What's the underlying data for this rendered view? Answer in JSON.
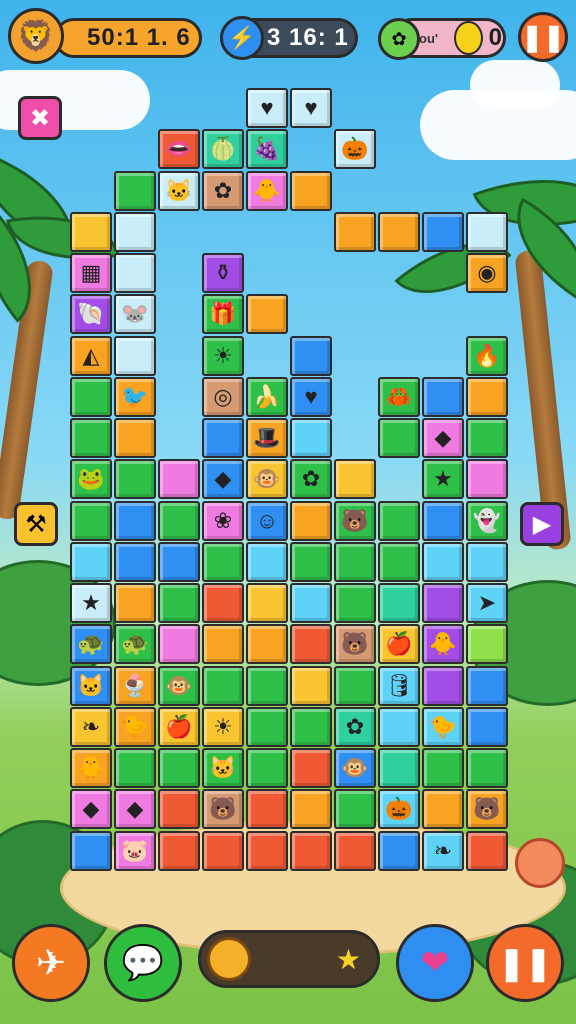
{
  "hud": {
    "score": "50:1 1. 6",
    "energy": "3 16: 1",
    "lives_text": "ou'",
    "coins": "0"
  },
  "colors": {
    "R": "#ef5a35",
    "O": "#f8a321",
    "Y": "#f9c531",
    "G": "#2fc04a",
    "L": "#8fe04a",
    "T": "#2fcfa0",
    "C": "#5fd3f7",
    "B": "#2f8ff2",
    "P": "#a24ee6",
    "K": "#f07be0",
    "M": "#d69a73",
    "E": "#c9eefa"
  },
  "board": {
    "cols": 10,
    "rows": [
      "....EE....",
      "..RTT.E...",
      ".GEMKO....",
      "YE....OOBE",
      "KE.P.....O",
      "PE.GO.....",
      "OE.G.B...G",
      "GO.MGB.GBO",
      "GO.BOC.GKG",
      "GGKBYGY.GK",
      "GBGKBOGGBG",
      "CBBGCGGGCC",
      "EOGRYCGTPC",
      "BGKOORMYPL",
      "BOGGGYGCPB",
      "YOYYGGTCCB",
      "OGGGGRBTGG",
      "KKRMROGCOO",
      "BKRRRRRBCR"
    ],
    "icons": [
      [
        0,
        4,
        "heart-icon"
      ],
      [
        0,
        5,
        "heart-icon"
      ],
      [
        0,
        6,
        "bird-icon"
      ],
      [
        1,
        2,
        "lips-icon"
      ],
      [
        1,
        3,
        "melon-icon"
      ],
      [
        1,
        4,
        "plum-icon"
      ],
      [
        1,
        5,
        "flower-icon"
      ],
      [
        1,
        6,
        "squash-icon"
      ],
      [
        2,
        0,
        "flower-icon"
      ],
      [
        2,
        2,
        "cat-icon"
      ],
      [
        2,
        3,
        "flower-icon"
      ],
      [
        2,
        4,
        "chick-icon"
      ],
      [
        2,
        7,
        "number-icon"
      ],
      [
        2,
        8,
        "number-icon"
      ],
      [
        3,
        2,
        "ghost-icon"
      ],
      [
        3,
        5,
        "squash-icon"
      ],
      [
        4,
        0,
        "net-icon"
      ],
      [
        4,
        3,
        "pot-icon"
      ],
      [
        4,
        6,
        "squash-icon"
      ],
      [
        4,
        9,
        "coin-icon"
      ],
      [
        5,
        0,
        "shell-icon"
      ],
      [
        5,
        1,
        "mouse-icon"
      ],
      [
        5,
        2,
        "pot-icon"
      ],
      [
        5,
        3,
        "gift-icon"
      ],
      [
        6,
        0,
        "cone-icon"
      ],
      [
        6,
        3,
        "sun-icon"
      ],
      [
        6,
        7,
        "mustache-icon"
      ],
      [
        6,
        9,
        "flame-icon"
      ],
      [
        7,
        1,
        "toucan-icon"
      ],
      [
        7,
        2,
        "leaf-icon"
      ],
      [
        7,
        3,
        "eye-icon"
      ],
      [
        7,
        4,
        "banana-icon"
      ],
      [
        7,
        5,
        "heart-icon"
      ],
      [
        7,
        6,
        "hedgehog-icon"
      ],
      [
        7,
        7,
        "crab-icon"
      ],
      [
        8,
        2,
        "gem-icon"
      ],
      [
        8,
        4,
        "hat-icon"
      ],
      [
        8,
        8,
        "gem-icon"
      ],
      [
        9,
        0,
        "frog-icon"
      ],
      [
        9,
        3,
        "gem-icon"
      ],
      [
        9,
        4,
        "monkey-icon"
      ],
      [
        9,
        5,
        "flower-icon"
      ],
      [
        9,
        8,
        "star-icon"
      ],
      [
        10,
        3,
        "bud-icon"
      ],
      [
        10,
        4,
        "face-icon"
      ],
      [
        10,
        6,
        "bear-icon"
      ],
      [
        10,
        9,
        "ghost-icon"
      ],
      [
        12,
        0,
        "star-icon"
      ],
      [
        12,
        9,
        "arrow-icon"
      ],
      [
        13,
        0,
        "turtle-icon"
      ],
      [
        13,
        1,
        "turtle-icon"
      ],
      [
        13,
        6,
        "bear-icon"
      ],
      [
        13,
        7,
        "apple-icon"
      ],
      [
        13,
        8,
        "chick-icon"
      ],
      [
        14,
        0,
        "cat-icon"
      ],
      [
        14,
        1,
        "sundae-icon"
      ],
      [
        14,
        2,
        "monkey-icon"
      ],
      [
        14,
        7,
        "barrel-icon"
      ],
      [
        15,
        0,
        "leaf-icon"
      ],
      [
        15,
        1,
        "bird-icon"
      ],
      [
        15,
        2,
        "apple-icon"
      ],
      [
        15,
        3,
        "sun-icon"
      ],
      [
        15,
        6,
        "flower-icon"
      ],
      [
        15,
        8,
        "bird-icon"
      ],
      [
        16,
        0,
        "chick-icon"
      ],
      [
        16,
        3,
        "cat-icon"
      ],
      [
        16,
        6,
        "monkey-icon"
      ],
      [
        17,
        0,
        "gem-icon"
      ],
      [
        17,
        1,
        "gem-icon"
      ],
      [
        17,
        3,
        "bear-icon"
      ],
      [
        17,
        7,
        "squash-icon"
      ],
      [
        17,
        9,
        "bear-icon"
      ],
      [
        18,
        1,
        "pig-icon"
      ],
      [
        18,
        8,
        "leaf-icon"
      ]
    ]
  }
}
